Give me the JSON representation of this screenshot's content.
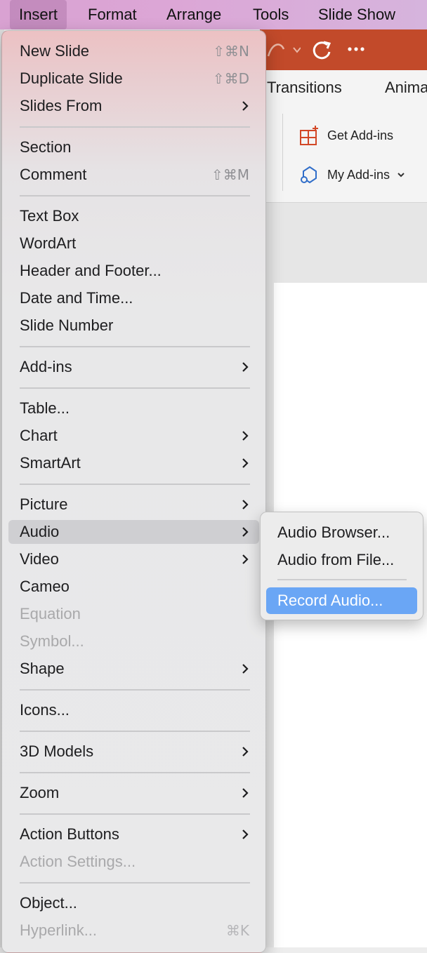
{
  "menubar": {
    "items": [
      {
        "label": "Insert"
      },
      {
        "label": "Format"
      },
      {
        "label": "Arrange"
      },
      {
        "label": "Tools"
      },
      {
        "label": "Slide Show"
      }
    ]
  },
  "ribbon": {
    "tabs": [
      {
        "label": "Transitions"
      },
      {
        "label": "Anima"
      }
    ],
    "get_addins": "Get Add-ins",
    "my_addins": "My Add-ins"
  },
  "insert_menu": {
    "items": [
      {
        "label": "New Slide",
        "shortcut": "⇧⌘N"
      },
      {
        "label": "Duplicate Slide",
        "shortcut": "⇧⌘D"
      },
      {
        "label": "Slides From"
      },
      {
        "label": "Section"
      },
      {
        "label": "Comment",
        "shortcut": "⇧⌘M"
      },
      {
        "label": "Text Box"
      },
      {
        "label": "WordArt"
      },
      {
        "label": "Header and Footer..."
      },
      {
        "label": "Date and Time..."
      },
      {
        "label": "Slide Number"
      },
      {
        "label": "Add-ins"
      },
      {
        "label": "Table..."
      },
      {
        "label": "Chart"
      },
      {
        "label": "SmartArt"
      },
      {
        "label": "Picture"
      },
      {
        "label": "Audio"
      },
      {
        "label": "Video"
      },
      {
        "label": "Cameo"
      },
      {
        "label": "Equation"
      },
      {
        "label": "Symbol..."
      },
      {
        "label": "Shape"
      },
      {
        "label": "Icons..."
      },
      {
        "label": "3D Models"
      },
      {
        "label": "Zoom"
      },
      {
        "label": "Action Buttons"
      },
      {
        "label": "Action Settings..."
      },
      {
        "label": "Object..."
      },
      {
        "label": "Hyperlink...",
        "shortcut": "⌘K"
      }
    ]
  },
  "audio_submenu": {
    "items": [
      {
        "label": "Audio Browser..."
      },
      {
        "label": "Audio from File..."
      },
      {
        "label": "Record Audio..."
      }
    ]
  }
}
